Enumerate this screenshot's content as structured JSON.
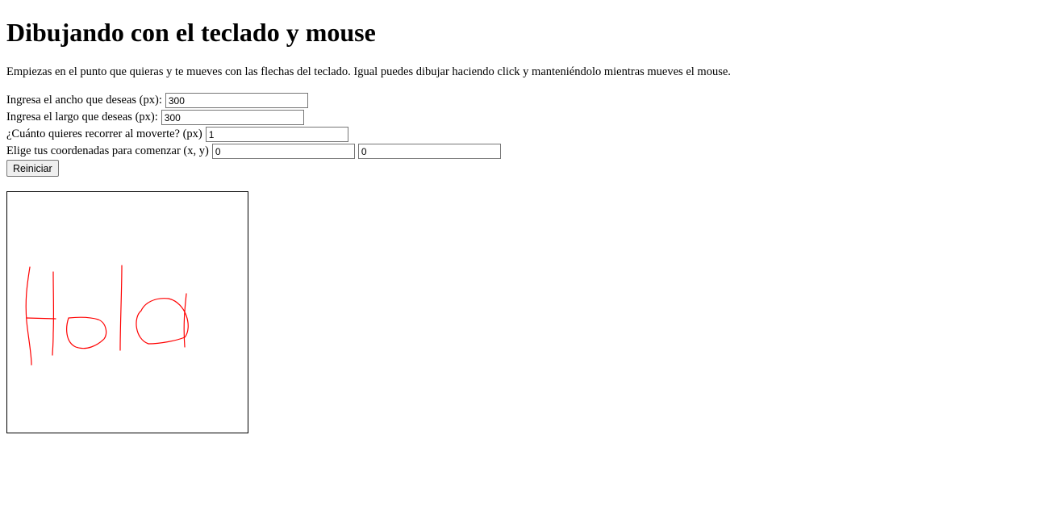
{
  "title": "Dibujando con el teclado y mouse",
  "intro": "Empiezas en el punto que quieras y te mueves con las flechas del teclado. Igual puedes dibujar haciendo click y manteniéndolo mientras mueves el mouse.",
  "form": {
    "width_label": "Ingresa el ancho que deseas (px):",
    "width_value": "300",
    "height_label": "Ingresa el largo que deseas (px):",
    "height_value": "300",
    "step_label": "¿Cuánto quieres recorrer al moverte? (px)",
    "step_value": "1",
    "coords_label": "Elige tus coordenadas para comenzar (x, y)",
    "x_value": "0",
    "y_value": "0",
    "reset_label": "Reiniciar"
  },
  "canvas": {
    "stroke_color": "#ff0000",
    "border_color": "#000000",
    "drawing_text": "Hola"
  }
}
